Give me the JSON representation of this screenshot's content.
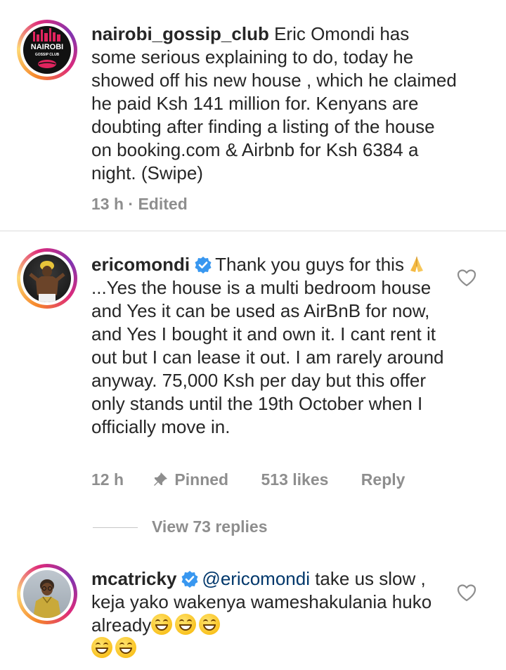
{
  "comments": [
    {
      "username": "nairobi_gossip_club",
      "avatar_label": "NAIROBI",
      "avatar_sub": "GOSSIP CLUB",
      "text": "Eric Omondi has some serious explaining to do, today he  showed off his new house , which he claimed he paid Ksh 141  million for. Kenyans are doubting after finding a listing of the house on booking.com & Airbnb for Ksh 6384 a night. (Swipe)",
      "time": "13 h · Edited"
    },
    {
      "username": "ericomondi",
      "verified": true,
      "text_a": "Thank you guys for this",
      "text_b": "...Yes the house is a multi bedroom house and Yes it can be used as AirBnB for now, and Yes I bought it and own it. I cant rent it out but I can lease it out. I am rarely around anyway. 75,000 Ksh per day but this offer only stands until the 19th October when I officially move in.",
      "time": "12 h",
      "pinned": "Pinned",
      "likes": "513 likes",
      "reply": "Reply",
      "view_replies": "View 73 replies"
    },
    {
      "username": "mcatricky",
      "verified": true,
      "mention": "@ericomondi",
      "text": " take us slow , keja yako wakenya wameshakulania huko  already",
      "emoji_count": 5
    }
  ],
  "colors": {
    "text": "#262626",
    "meta": "#8e8e8e",
    "mention": "#00376b",
    "verified": "#3897f0"
  }
}
